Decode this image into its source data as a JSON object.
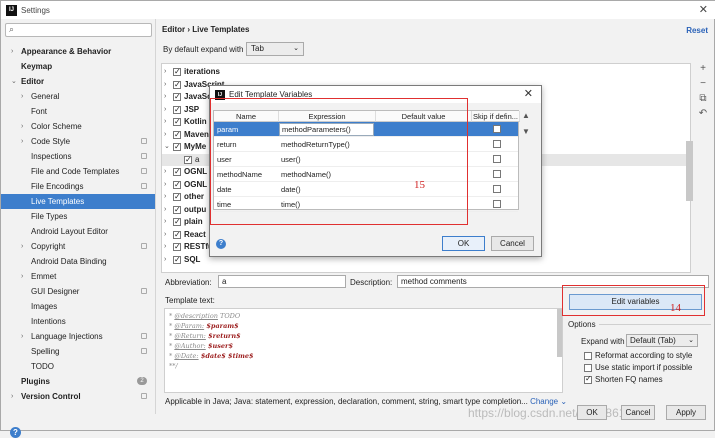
{
  "window": {
    "title": "Settings",
    "app_icon": "IJ"
  },
  "sidebar": {
    "search_placeholder": "",
    "items": [
      {
        "label": "Appearance & Behavior",
        "bold": true,
        "arrow": "›",
        "indent": 0
      },
      {
        "label": "Keymap",
        "bold": true,
        "arrow": "",
        "indent": 0
      },
      {
        "label": "Editor",
        "bold": true,
        "arrow": "⌄",
        "indent": 0
      },
      {
        "label": "General",
        "arrow": "›",
        "indent": 1
      },
      {
        "label": "Font",
        "arrow": "",
        "indent": 1
      },
      {
        "label": "Color Scheme",
        "arrow": "›",
        "indent": 1
      },
      {
        "label": "Code Style",
        "arrow": "›",
        "indent": 1,
        "copy": true
      },
      {
        "label": "Inspections",
        "arrow": "",
        "indent": 1,
        "copy": true
      },
      {
        "label": "File and Code Templates",
        "arrow": "",
        "indent": 1,
        "copy": true
      },
      {
        "label": "File Encodings",
        "arrow": "",
        "indent": 1,
        "copy": true
      },
      {
        "label": "Live Templates",
        "arrow": "",
        "indent": 1,
        "selected": true
      },
      {
        "label": "File Types",
        "arrow": "",
        "indent": 1
      },
      {
        "label": "Android Layout Editor",
        "arrow": "",
        "indent": 1
      },
      {
        "label": "Copyright",
        "arrow": "›",
        "indent": 1,
        "copy": true
      },
      {
        "label": "Android Data Binding",
        "arrow": "",
        "indent": 1
      },
      {
        "label": "Emmet",
        "arrow": "›",
        "indent": 1
      },
      {
        "label": "GUI Designer",
        "arrow": "",
        "indent": 1,
        "copy": true
      },
      {
        "label": "Images",
        "arrow": "",
        "indent": 1
      },
      {
        "label": "Intentions",
        "arrow": "",
        "indent": 1
      },
      {
        "label": "Language Injections",
        "arrow": "›",
        "indent": 1,
        "copy": true
      },
      {
        "label": "Spelling",
        "arrow": "",
        "indent": 1,
        "copy": true
      },
      {
        "label": "TODO",
        "arrow": "",
        "indent": 1
      },
      {
        "label": "Plugins",
        "bold": true,
        "arrow": "",
        "indent": 0,
        "badge": "2"
      },
      {
        "label": "Version Control",
        "bold": true,
        "arrow": "›",
        "indent": 0,
        "copy": true
      }
    ]
  },
  "main": {
    "breadcrumb": "Editor  ›  Live Templates",
    "reset": "Reset",
    "expand_label": "By default expand with",
    "expand_value": "Tab",
    "tree": [
      {
        "label": "iterations",
        "arrow": "›",
        "checked": true
      },
      {
        "label": "JavaScript",
        "arrow": "›",
        "checked": true
      },
      {
        "label": "JavaSc",
        "arrow": "›",
        "checked": true
      },
      {
        "label": "JSP",
        "arrow": "›",
        "checked": true
      },
      {
        "label": "Kotlin",
        "arrow": "›",
        "checked": true
      },
      {
        "label": "Maven",
        "arrow": "›",
        "checked": true
      },
      {
        "label": "MyMe",
        "arrow": "⌄",
        "checked": true
      },
      {
        "label": "a",
        "arrow": "",
        "checked": true,
        "child": true
      },
      {
        "label": "OGNL",
        "arrow": "›",
        "checked": true
      },
      {
        "label": "OGNL",
        "arrow": "›",
        "checked": true
      },
      {
        "label": "other",
        "arrow": "›",
        "checked": true
      },
      {
        "label": "outpu",
        "arrow": "›",
        "checked": true
      },
      {
        "label": "plain",
        "arrow": "›",
        "checked": true
      },
      {
        "label": "React",
        "arrow": "›",
        "checked": true
      },
      {
        "label": "RESTfu",
        "arrow": "›",
        "checked": true
      },
      {
        "label": "SQL",
        "arrow": "›",
        "checked": true
      }
    ],
    "tree_buttons": [
      "+",
      "−",
      "⧉",
      "↶"
    ],
    "abbreviation_label": "Abbreviation:",
    "abbreviation_value": "a",
    "description_label": "Description:",
    "description_value": "method comments",
    "template_text_label": "Template text:",
    "template_lines": [
      {
        "tag": "@description",
        "text": " TODO"
      },
      {
        "tag": "@Param:",
        "text": " $param$"
      },
      {
        "tag": "@Return:",
        "text": " $return$"
      },
      {
        "tag": "@Author:",
        "text": " $user$"
      },
      {
        "tag": "@Date:",
        "text": " $date$ $time$"
      }
    ],
    "template_end": "**/",
    "applicable": "Applicable in Java; Java: statement, expression, declaration, comment, string, smart type completion...",
    "change": "Change ⌄",
    "edit_variables": "Edit variables",
    "annotation_14": "14",
    "options_label": "Options",
    "expand_with_label": "Expand with",
    "expand_with_value": "Default (Tab)",
    "options": [
      {
        "label": "Reformat according to style",
        "checked": false
      },
      {
        "label": "Use static import if possible",
        "checked": false
      },
      {
        "label": "Shorten FQ names",
        "checked": true
      }
    ],
    "ok": "OK",
    "cancel": "Cancel",
    "apply": "Apply",
    "watermark": "https://blog.csdn.net/qq_38617097"
  },
  "dialog": {
    "title": "Edit Template Variables",
    "columns": [
      "Name",
      "Expression",
      "Default value",
      "Skip if defin..."
    ],
    "rows": [
      {
        "name": "param",
        "expression": "methodParameters()",
        "default": "",
        "skip": false,
        "selected": true
      },
      {
        "name": "return",
        "expression": "methodReturnType()",
        "default": "",
        "skip": false
      },
      {
        "name": "user",
        "expression": "user()",
        "default": "",
        "skip": false
      },
      {
        "name": "methodName",
        "expression": "methodName()",
        "default": "",
        "skip": false
      },
      {
        "name": "date",
        "expression": "date()",
        "default": "",
        "skip": false
      },
      {
        "name": "time",
        "expression": "time()",
        "default": "",
        "skip": false
      }
    ],
    "annotation_15": "15",
    "ok": "OK",
    "cancel": "Cancel"
  },
  "colors": {
    "selection": "#3d7ecc",
    "annotation": "#e03030",
    "link": "#2a62b8"
  }
}
